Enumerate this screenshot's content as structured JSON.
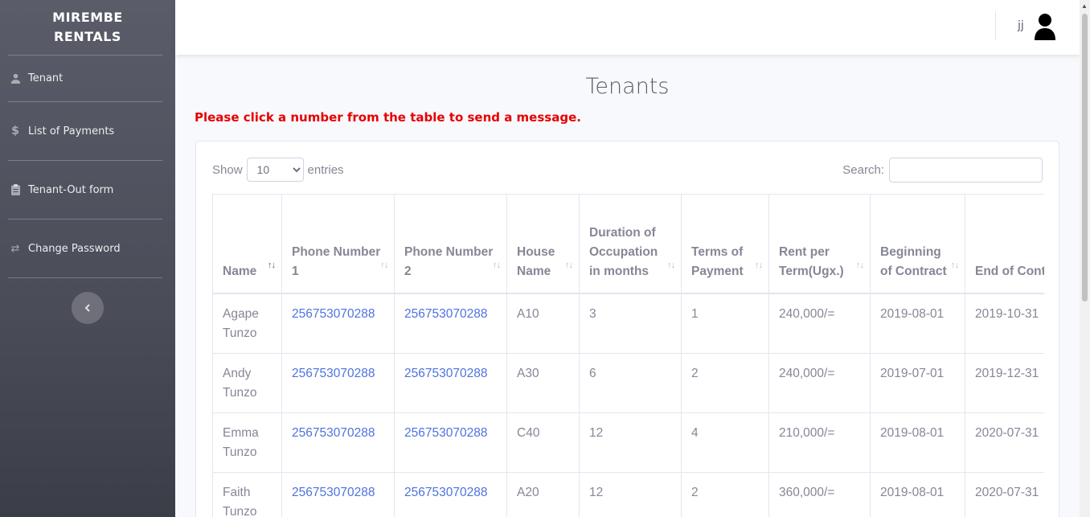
{
  "brand": {
    "line1": "MIREMBE",
    "line2": "RENTALS"
  },
  "sidebar": {
    "items": [
      {
        "label": "Tenant",
        "icon": "user-icon"
      },
      {
        "label": "List of Payments",
        "icon": "dollar-icon"
      },
      {
        "label": "Tenant-Out form",
        "icon": "clipboard-icon"
      },
      {
        "label": "Change Password",
        "icon": "exchange-icon"
      }
    ],
    "toggle_icon": "chevron-left-icon"
  },
  "topbar": {
    "username": "jj",
    "avatar_icon": "user-avatar-icon"
  },
  "main": {
    "title": "Tenants",
    "notice": "Please click a number from the table to send a message.",
    "show_label": "Show",
    "entries_label": "entries",
    "entries_value": "10",
    "search_label": "Search:"
  },
  "table": {
    "headers": [
      "Name",
      "Phone Number 1",
      "Phone Number 2",
      "House Name",
      "Duration of Occupation in months",
      "Terms of Payment",
      "Rent per Term(Ugx.)",
      "Beginning of Contract",
      "End of Contract"
    ],
    "rows": [
      [
        "Agape Tunzo",
        "256753070288",
        "256753070288",
        "A10",
        "3",
        "1",
        "240,000/=",
        "2019-08-01",
        "2019-10-31"
      ],
      [
        "Andy Tunzo",
        "256753070288",
        "256753070288",
        "A30",
        "6",
        "2",
        "240,000/=",
        "2019-07-01",
        "2019-12-31"
      ],
      [
        "Emma Tunzo",
        "256753070288",
        "256753070288",
        "C40",
        "12",
        "4",
        "210,000/=",
        "2019-08-01",
        "2020-07-31"
      ],
      [
        "Faith Tunzo",
        "256753070288",
        "256753070288",
        "A20",
        "12",
        "2",
        "360,000/=",
        "2019-08-01",
        "2020-07-31"
      ]
    ]
  },
  "colors": {
    "notice": "#e60000",
    "link": "#4e73df",
    "sidebar": "#5a5c69"
  }
}
